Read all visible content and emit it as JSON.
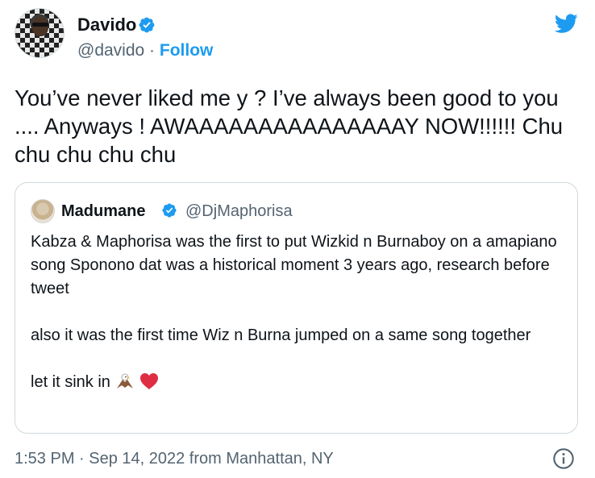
{
  "author": {
    "name": "Davido",
    "handle": "@davido",
    "separator": "·",
    "follow_label": "Follow"
  },
  "tweet": {
    "text": "You’ve never liked me y ? I’ve always been good to you .... Anyways ! AWAAAAAAAAAAAAAAAY NOW!!!!!! Chu chu chu chu chu"
  },
  "quoted": {
    "name": "Madumane",
    "handle": "@DjMaphorisa",
    "paragraph_1": "Kabza & Maphorisa was the first to put Wizkid n Burnaboy on a amapiano song Sponono dat was a historical moment 3 years ago, research before tweet",
    "paragraph_2": "also it was the first time Wiz n Burna jumped on a same song together",
    "paragraph_3": "let it sink in"
  },
  "meta": {
    "timestamp": "1:53 PM · Sep 14, 2022 from Manhattan, NY"
  },
  "colors": {
    "accent": "#1d9bf0",
    "text": "#0f1419",
    "secondary": "#536471",
    "border": "#cfd9de",
    "heart": "#e0245e"
  },
  "icons": [
    "verified-badge-icon",
    "twitter-bird-icon",
    "eagle-emoji-icon",
    "red-heart-emoji-icon",
    "info-icon"
  ]
}
